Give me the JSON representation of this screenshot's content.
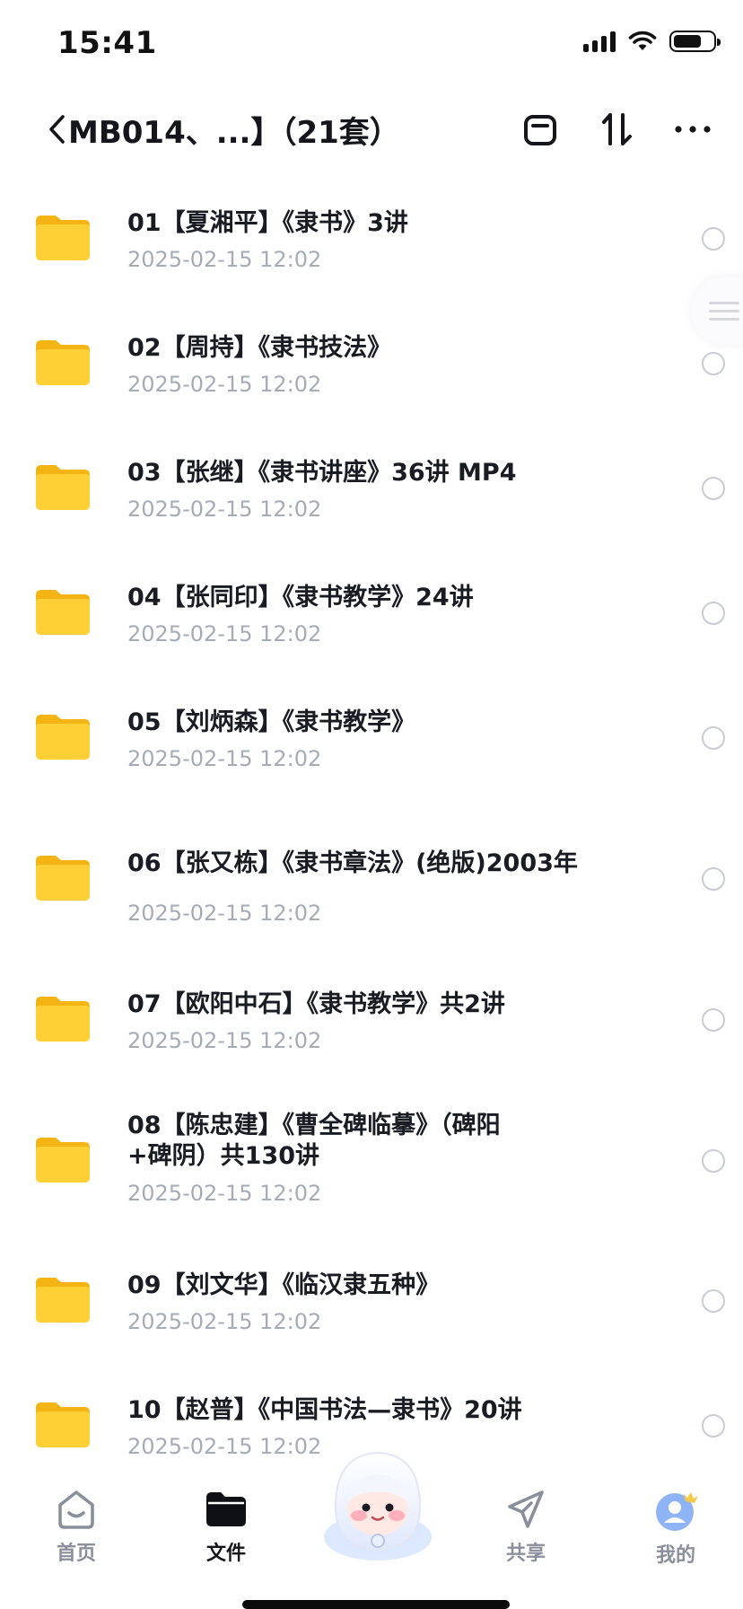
{
  "status_bar": {
    "time": "15:41",
    "battery_level": 0.72
  },
  "header": {
    "title": "MB014、...】（21套）"
  },
  "files": [
    {
      "name": "01【夏湘平】《隶书》3讲",
      "date": "2025-02-15 12:02"
    },
    {
      "name": "02【周持】《隶书技法》",
      "date": "2025-02-15 12:02"
    },
    {
      "name": "03【张继】《隶书讲座》36讲 MP4",
      "date": "2025-02-15 12:02"
    },
    {
      "name": "04【张同印】《隶书教学》24讲",
      "date": "2025-02-15 12:02"
    },
    {
      "name": "05【刘炳森】《隶书教学》",
      "date": "2025-02-15 12:02"
    },
    {
      "name": "06【张又栋】《隶书章法》(绝版)2003年",
      "date": "2025-02-15 12:02"
    },
    {
      "name": "07【欧阳中石】《隶书教学》共2讲",
      "date": "2025-02-15 12:02"
    },
    {
      "name": "08【陈忠建】《曹全碑临摹》（碑阳",
      "name_line2": "+碑阴）共130讲",
      "date": "2025-02-15 12:02"
    },
    {
      "name": "09【刘文华】《临汉隶五种》",
      "date": "2025-02-15 12:02"
    },
    {
      "name": "10【赵普】《中国书法—隶书》20讲",
      "date": "2025-02-15 12:02"
    }
  ],
  "tab_bar": {
    "tabs": [
      {
        "label": "首页",
        "icon": "home-icon",
        "active": false
      },
      {
        "label": "文件",
        "icon": "folder-icon",
        "active": true
      },
      {
        "label": "共享",
        "icon": "paper-plane-icon",
        "active": false
      },
      {
        "label": "我的",
        "icon": "profile-icon",
        "active": false
      }
    ]
  },
  "colors": {
    "folder": "#FFC928",
    "accent": "#14161C",
    "date_text": "#A6ABB8",
    "avatar": "#8FB4F5"
  }
}
